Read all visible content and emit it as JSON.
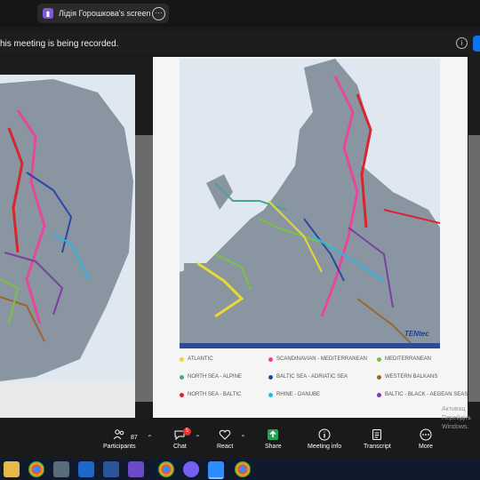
{
  "share_tab": {
    "label": "Лідія Горошкова's screen"
  },
  "banner": {
    "text": "his meeting is being recorded."
  },
  "map": {
    "brand": "TEN",
    "brand_suffix": "tec",
    "legend": [
      {
        "label": "ATLANTIC",
        "color": "#e8d830"
      },
      {
        "label": "SCANDINAVIAN - MEDITERRANEAN",
        "color": "#e8469b"
      },
      {
        "label": "MEDITERRANEAN",
        "color": "#7ac143"
      },
      {
        "label": "NORTH SEA - ALPINE",
        "color": "#4aa58a"
      },
      {
        "label": "BALTIC SEA - ADRIATIC SEA",
        "color": "#2a4aa0"
      },
      {
        "label": "WESTERN BALKANS",
        "color": "#a0642a"
      },
      {
        "label": "NORTH SEA - BALTIC",
        "color": "#d8262e"
      },
      {
        "label": "RHINE - DANUBE",
        "color": "#2fb4e4"
      },
      {
        "label": "BALTIC - BLACK - AEGEAN SEAS",
        "color": "#7b3fa0"
      }
    ]
  },
  "toolbar": {
    "participants_count": "87",
    "participants_label": "Participants",
    "chat_label": "Chat",
    "chat_badge": "5",
    "react_label": "React",
    "share_label": "Share",
    "meeting_info_label": "Meeting info",
    "transcript_label": "Transcript",
    "more_label": "More"
  },
  "windows_watermark": {
    "line1": "Активац",
    "line2": "Перейдіть",
    "line3": "Windows."
  }
}
